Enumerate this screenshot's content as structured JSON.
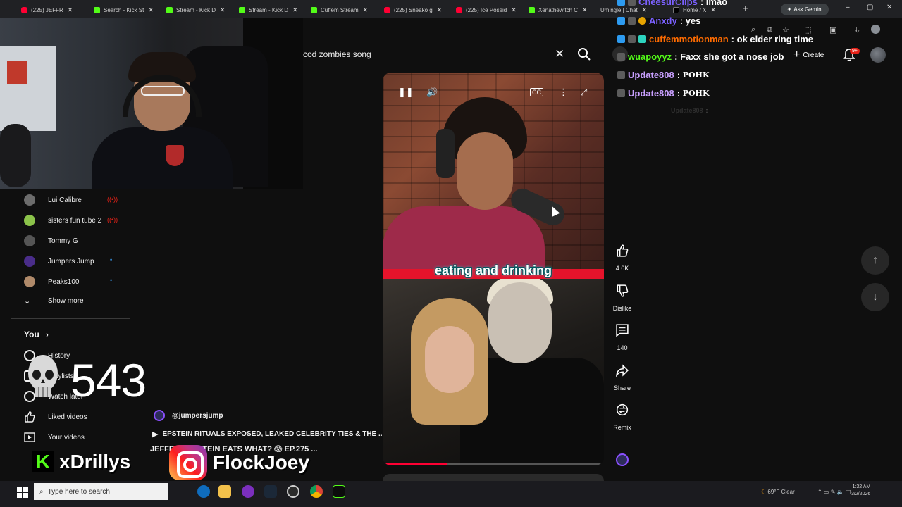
{
  "browser": {
    "tabs": [
      {
        "label": "(225) JEFFR",
        "favicon": "youtube-icon"
      },
      {
        "label": "Search - Kick St",
        "favicon": "kick-icon"
      },
      {
        "label": "Stream - Kick D",
        "favicon": "kick-icon"
      },
      {
        "label": "Stream - Kick D",
        "favicon": "kick-icon"
      },
      {
        "label": "Cuffem Stream",
        "favicon": "kick-icon"
      },
      {
        "label": "(225) Sneako g",
        "favicon": "youtube-icon"
      },
      {
        "label": "(225) Ice Poseid",
        "favicon": "youtube-icon"
      },
      {
        "label": "Xenathewitch C",
        "favicon": "kick-icon"
      },
      {
        "label": "Umingle | Chat",
        "favicon": "chat-icon"
      },
      {
        "label": "Home / X",
        "favicon": "x-icon"
      }
    ],
    "new_tab": "+",
    "ask_gemini": "Ask Gemini",
    "window_controls": [
      "–",
      "▢",
      "✕"
    ]
  },
  "youtube": {
    "search_value": "cod zombies song",
    "clear_symbol": "✕",
    "create_label": "Create",
    "notification_count": "9+"
  },
  "chat": {
    "messages": [
      {
        "user": "CheesurClips",
        "message": "lmao",
        "user_color": "#7b61ff"
      },
      {
        "user": "Anxdy",
        "message": "yes",
        "user_color": "#7b61ff"
      },
      {
        "user": "cuffemmotionman",
        "message": "ok elder ring time",
        "user_color": "#ff6b00"
      },
      {
        "user": "wuapoyyz",
        "message": "Faxx she got a nose job",
        "user_color": "#53fc18"
      },
      {
        "user": "Update808",
        "message": "POHK",
        "user_color": "#c9a0ff"
      },
      {
        "user": "Update808",
        "message": "POHK",
        "user_color": "#c9a0ff"
      },
      {
        "user": "Update808",
        "message": "",
        "user_color": "#555555"
      }
    ]
  },
  "sidebar": {
    "subscriptions": [
      {
        "name": "Lui Calibre",
        "indicator": "live"
      },
      {
        "name": "sisters fun tube 2",
        "indicator": "live"
      },
      {
        "name": "Tommy G",
        "indicator": ""
      },
      {
        "name": "Jumpers Jump",
        "indicator": "new"
      },
      {
        "name": "Peaks100",
        "indicator": "new"
      }
    ],
    "show_more": "Show more",
    "you_heading": "You",
    "you_items": [
      {
        "label": "History",
        "icon": "history-icon"
      },
      {
        "label": "Playlists",
        "icon": "playlist-icon"
      },
      {
        "label": "Watch later",
        "icon": "clock-icon"
      },
      {
        "label": "Liked videos",
        "icon": "thumbs-up-icon"
      },
      {
        "label": "Your videos",
        "icon": "video-icon"
      }
    ]
  },
  "overlay": {
    "counter": "543",
    "kick_handle": "xDrillys",
    "instagram_handle": "FlockJoey"
  },
  "video_info": {
    "channel": "@jumpersjump",
    "title": "EPSTEIN RITUALS EXPOSED, LEAKED CELEBRITY TIES & THE ...",
    "title2": "JEFFREY EPSTEIN EATS WHAT? 😱 EP.275 ..."
  },
  "short": {
    "caption": "eating and drinking",
    "progress": 0.29
  },
  "actions": {
    "like_count": "4.6K",
    "dislike_label": "Dislike",
    "comment_count": "140",
    "share_label": "Share",
    "remix_label": "Remix"
  },
  "taskbar": {
    "search_placeholder": "Type here to search",
    "weather": "69°F Clear",
    "time": "1:32 AM",
    "date": "3/2/2026"
  }
}
